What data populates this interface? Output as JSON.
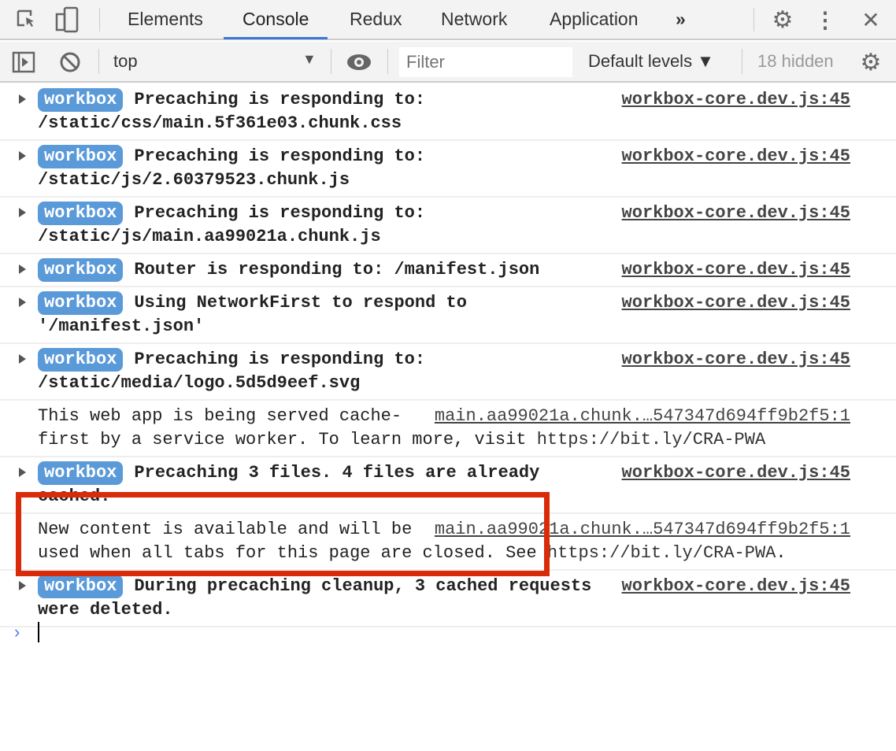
{
  "tabs": [
    "Elements",
    "Console",
    "Redux",
    "Network",
    "Application"
  ],
  "active_tab": "Console",
  "more_tabs": "»",
  "toolbar": {
    "context": "top",
    "filter_placeholder": "Filter",
    "levels": "Default levels ▼",
    "hidden": "18 hidden"
  },
  "badge": "workbox",
  "messages": [
    {
      "type": "workbox",
      "text": "Precaching is responding to: /static/css/main.5f361e03.chunk.css",
      "source": "workbox-core.dev.js:45"
    },
    {
      "type": "workbox",
      "text": "Precaching is responding to: /static/js/2.60379523.chunk.js",
      "source": "workbox-core.dev.js:45"
    },
    {
      "type": "workbox",
      "text": "Precaching is responding to: /static/js/main.aa99021a.chunk.js",
      "source": "workbox-core.dev.js:45"
    },
    {
      "type": "workbox",
      "text": "Router is responding to: /manifest.json",
      "source": "workbox-core.dev.js:45"
    },
    {
      "type": "workbox",
      "text": "Using NetworkFirst to respond to '/manifest.json'",
      "source": "workbox-core.dev.js:45"
    },
    {
      "type": "workbox",
      "text": "Precaching is responding to: /static/media/logo.5d5d9eef.svg",
      "source": "workbox-core.dev.js:45"
    },
    {
      "type": "plain",
      "text": "This web app is being served cache-first by a service worker. To learn more, visit ",
      "link": "https://bit.ly/CRA-PWA",
      "after": "",
      "source": "main.aa99021a.chunk.…547347d694ff9b2f5:1"
    },
    {
      "type": "workbox",
      "text": "Precaching 3 files. 4 files are already cached.",
      "source": "workbox-core.dev.js:45"
    },
    {
      "type": "plain",
      "text": "New content is available and will be used when all tabs for this page are closed. See ",
      "link": "https://bit.ly/CRA-PWA",
      "after": ".",
      "source": "main.aa99021a.chunk.…547347d694ff9b2f5:1"
    },
    {
      "type": "workbox",
      "text": "During precaching cleanup, 3 cached requests were deleted.",
      "source": "workbox-core.dev.js:45"
    }
  ],
  "prompt": "›",
  "highlight_color": "#d92a0a"
}
